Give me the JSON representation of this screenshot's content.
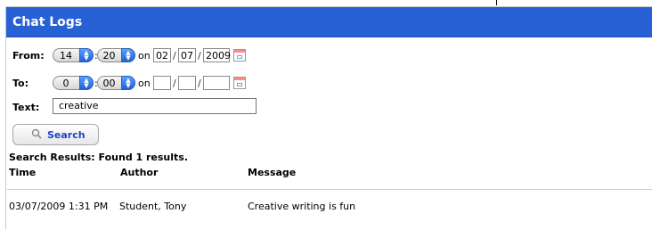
{
  "window": {
    "title": "Chat Logs"
  },
  "from": {
    "label": "From:",
    "hour": "14",
    "minute": "20",
    "on": "on",
    "day": "02",
    "month": "07",
    "year": "2009"
  },
  "to": {
    "label": "To:",
    "hour": "0",
    "minute": "00",
    "on": "on",
    "day": "",
    "month": "",
    "year": ""
  },
  "text": {
    "label": "Text:",
    "value": "creative"
  },
  "search_button": {
    "label": "Search",
    "icon": "magnifier-icon"
  },
  "results": {
    "summary": "Search Results: Found 1 results.",
    "columns": [
      "Time",
      "Author",
      "Message"
    ],
    "rows": [
      {
        "time": "03/07/2009 1:31 PM",
        "author": "Student, Tony",
        "message": "Creative writing is fun"
      }
    ]
  },
  "colors": {
    "titlebar": "#2860d6",
    "button_text": "#1d46c8"
  }
}
